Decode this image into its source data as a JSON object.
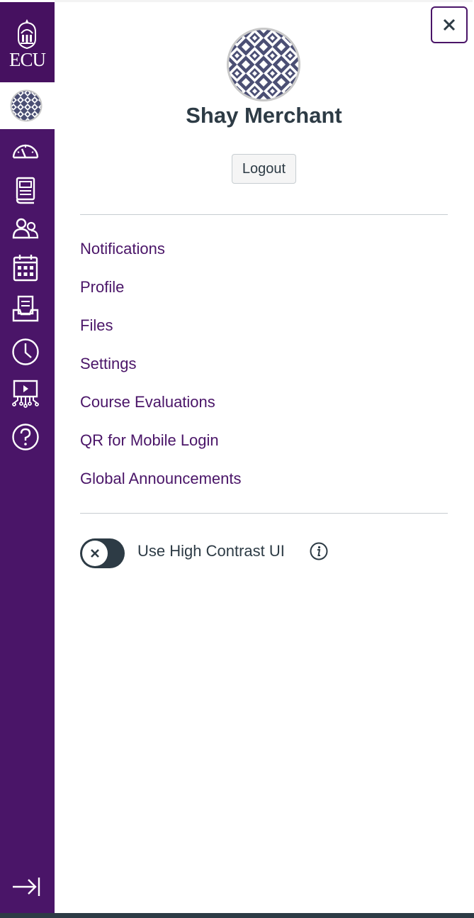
{
  "global_nav": {
    "logo_text": "ECU",
    "items": [
      {
        "name": "account",
        "icon": "avatar-icon"
      },
      {
        "name": "dashboard",
        "icon": "dashboard-icon"
      },
      {
        "name": "courses",
        "icon": "courses-icon"
      },
      {
        "name": "groups",
        "icon": "groups-icon"
      },
      {
        "name": "calendar",
        "icon": "calendar-icon"
      },
      {
        "name": "inbox",
        "icon": "inbox-icon"
      },
      {
        "name": "history",
        "icon": "clock-icon"
      },
      {
        "name": "studio",
        "icon": "studio-icon"
      },
      {
        "name": "help",
        "icon": "help-icon"
      }
    ],
    "collapse_icon": "collapse-arrow-icon"
  },
  "account_tray": {
    "close_icon": "close-icon",
    "user_name": "Shay Merchant",
    "logout_label": "Logout",
    "links": [
      "Notifications",
      "Profile",
      "Files",
      "Settings",
      "Course Evaluations",
      "QR for Mobile Login",
      "Global Announcements"
    ],
    "high_contrast": {
      "label": "Use High Contrast UI",
      "enabled": false,
      "info_icon": "info-icon"
    }
  },
  "colors": {
    "brand_purple": "#4a1568",
    "text_dark": "#2d3b45",
    "divider": "#c7cdd1"
  }
}
